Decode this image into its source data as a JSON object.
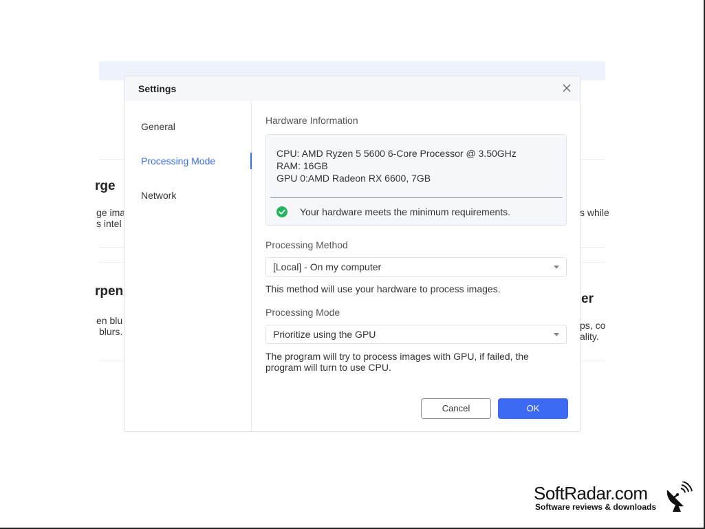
{
  "background": {
    "fragments": {
      "title1": "rge",
      "line1a": "ge ima",
      "line1b": "s intel",
      "right1": "s while",
      "title2": "rpen",
      "line2a": "en blu",
      "line2b": "blurs.",
      "title3": "er",
      "right2a": "ps, co",
      "right2b": "ality."
    }
  },
  "dialog": {
    "title": "Settings",
    "close_icon": "close-icon",
    "sidebar": {
      "items": [
        {
          "label": "General",
          "active": false
        },
        {
          "label": "Processing Mode",
          "active": true
        },
        {
          "label": "Network",
          "active": false
        }
      ]
    },
    "hardware": {
      "heading": "Hardware Information",
      "cpu": "CPU: AMD Ryzen 5 5600 6-Core Processor @ 3.50GHz",
      "ram": "RAM: 16GB",
      "gpu": "GPU 0:AMD Radeon RX 6600, 7GB",
      "status": "Your hardware meets the minimum requirements.",
      "status_icon": "check-circle-icon",
      "status_color": "#21b35e"
    },
    "processing_method": {
      "label": "Processing Method",
      "value": "[Local] - On my computer",
      "description": "This method will use your hardware to process images."
    },
    "processing_mode": {
      "label": "Processing Mode",
      "value": "Prioritize using the GPU",
      "description": "The program will try to process images with GPU, if failed, the program will turn to use CPU."
    },
    "buttons": {
      "cancel": "Cancel",
      "ok": "OK"
    },
    "accent_color": "#3d6af2"
  },
  "watermark": {
    "title": "SoftRadar.com",
    "subtitle": "Software reviews & downloads",
    "icon": "satellite-dish-icon"
  }
}
